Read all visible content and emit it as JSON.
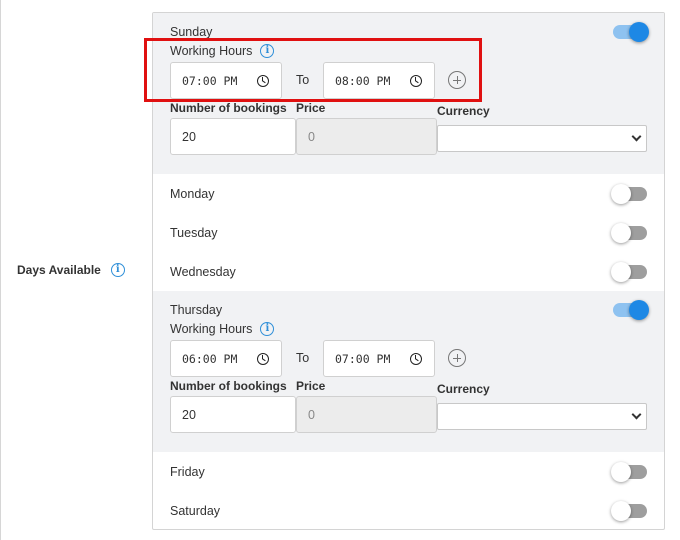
{
  "row_label": "Days Available",
  "labels": {
    "working_hours": "Working Hours",
    "to": "To",
    "bookings": "Number of bookings",
    "price": "Price",
    "currency": "Currency"
  },
  "days": [
    {
      "name": "Sunday",
      "enabled": true,
      "start": "07:00 PM",
      "end": "08:00 PM",
      "bookings": "20",
      "price": "0",
      "currency": ""
    },
    {
      "name": "Monday",
      "enabled": false
    },
    {
      "name": "Tuesday",
      "enabled": false
    },
    {
      "name": "Wednesday",
      "enabled": false
    },
    {
      "name": "Thursday",
      "enabled": true,
      "start": "06:00 PM",
      "end": "07:00 PM",
      "bookings": "20",
      "price": "0",
      "currency": ""
    },
    {
      "name": "Friday",
      "enabled": false
    },
    {
      "name": "Saturday",
      "enabled": false
    }
  ],
  "colors": {
    "toggle_on": "#1e88e5",
    "info": "#2f8fd8",
    "highlight": "#e01010"
  }
}
